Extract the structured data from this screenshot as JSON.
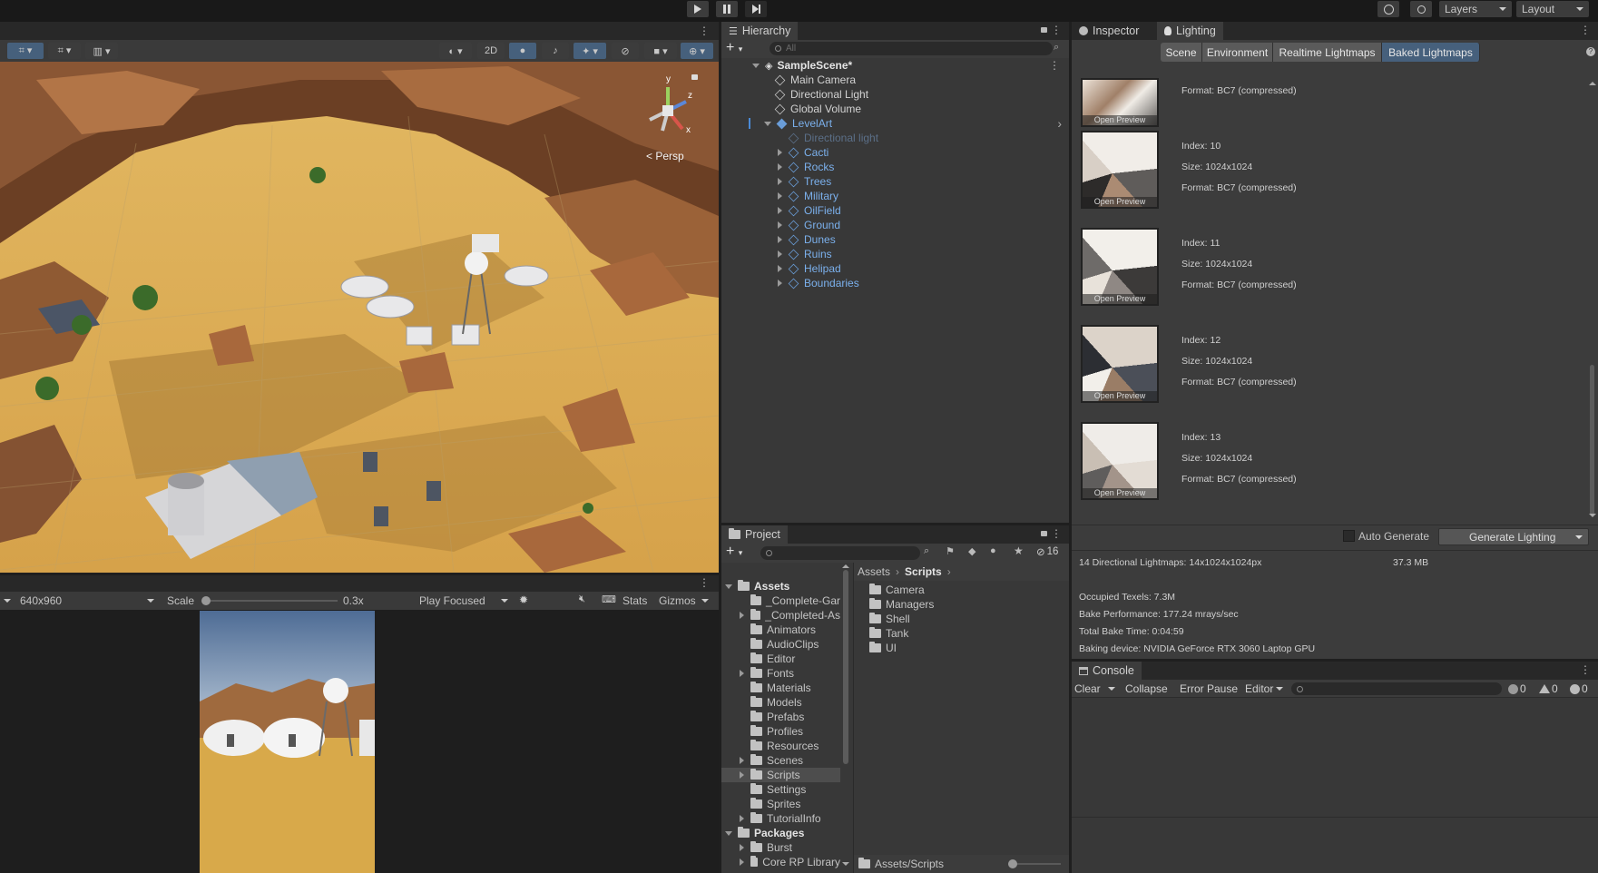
{
  "toolbar": {
    "play_icon": "play-icon",
    "pause_icon": "pause-icon",
    "step_icon": "step-icon",
    "layers_label": "Layers",
    "layout_label": "Layout"
  },
  "scene_view": {
    "persp_label": "< Persp",
    "mode_2d_label": "2D",
    "gizmo_axes": [
      "y",
      "z",
      "x"
    ]
  },
  "game_view": {
    "resolution": "640x960",
    "scale_label": "Scale",
    "scale_value": "0.3x",
    "scale_level": 0.0,
    "play_mode": "Play Focused",
    "stats_label": "Stats",
    "gizmos_label": "Gizmos"
  },
  "hierarchy": {
    "tab_label": "Hierarchy",
    "search_placeholder": "All",
    "scene_name": "SampleScene*",
    "items": [
      {
        "label": "Main Camera",
        "indent": 1,
        "state": "normal"
      },
      {
        "label": "Directional Light",
        "indent": 1,
        "state": "normal"
      },
      {
        "label": "Global Volume",
        "indent": 1,
        "state": "normal"
      },
      {
        "label": "LevelArt",
        "indent": 1,
        "state": "prefab-expanded"
      },
      {
        "label": "Directional light",
        "indent": 2,
        "state": "disabled"
      },
      {
        "label": "Cacti",
        "indent": 2,
        "state": "prefab"
      },
      {
        "label": "Rocks",
        "indent": 2,
        "state": "prefab"
      },
      {
        "label": "Trees",
        "indent": 2,
        "state": "prefab"
      },
      {
        "label": "Military",
        "indent": 2,
        "state": "prefab"
      },
      {
        "label": "OilField",
        "indent": 2,
        "state": "prefab"
      },
      {
        "label": "Ground",
        "indent": 2,
        "state": "prefab"
      },
      {
        "label": "Dunes",
        "indent": 2,
        "state": "prefab"
      },
      {
        "label": "Ruins",
        "indent": 2,
        "state": "prefab"
      },
      {
        "label": "Helipad",
        "indent": 2,
        "state": "prefab"
      },
      {
        "label": "Boundaries",
        "indent": 2,
        "state": "prefab"
      }
    ]
  },
  "inspector": {
    "tab_inspector": "Inspector",
    "tab_lighting": "Lighting",
    "segments": [
      "Scene",
      "Environment",
      "Realtime Lightmaps",
      "Baked Lightmaps"
    ],
    "active_segment": "Baked Lightmaps",
    "top_format": "Format: BC7 (compressed)",
    "open_preview": "Open Preview",
    "lightmaps": [
      {
        "index": "Index: 10",
        "size": "Size: 1024x1024",
        "format": "Format: BC7 (compressed)"
      },
      {
        "index": "Index: 11",
        "size": "Size: 1024x1024",
        "format": "Format: BC7 (compressed)"
      },
      {
        "index": "Index: 12",
        "size": "Size: 1024x1024",
        "format": "Format: BC7 (compressed)"
      },
      {
        "index": "Index: 13",
        "size": "Size: 1024x1024",
        "format": "Format: BC7 (compressed)"
      }
    ],
    "auto_generate_label": "Auto Generate",
    "generate_button": "Generate Lighting",
    "summary_lightmaps": "14 Directional Lightmaps: 14x1024x1024px",
    "summary_size": "37.3 MB",
    "stats": [
      "Occupied Texels: 7.3M",
      "Bake Performance: 177.24 mrays/sec",
      "Total Bake Time: 0:04:59",
      "Baking device: NVIDIA GeForce RTX 3060 Laptop GPU"
    ]
  },
  "project": {
    "tab_label": "Project",
    "hidden_count": "16",
    "breadcrumb_root": "Assets",
    "breadcrumb_current": "Scripts",
    "tree": [
      {
        "label": "Assets",
        "type": "root",
        "expanded": true
      },
      {
        "label": "_Complete-Gar",
        "type": "folder",
        "arrow": false
      },
      {
        "label": "_Completed-As",
        "type": "folder",
        "arrow": true
      },
      {
        "label": "Animators",
        "type": "folder",
        "arrow": false
      },
      {
        "label": "AudioClips",
        "type": "folder",
        "arrow": false
      },
      {
        "label": "Editor",
        "type": "folder",
        "arrow": false
      },
      {
        "label": "Fonts",
        "type": "folder",
        "arrow": true
      },
      {
        "label": "Materials",
        "type": "folder",
        "arrow": false
      },
      {
        "label": "Models",
        "type": "folder",
        "arrow": false
      },
      {
        "label": "Prefabs",
        "type": "folder",
        "arrow": false
      },
      {
        "label": "Profiles",
        "type": "folder",
        "arrow": false
      },
      {
        "label": "Resources",
        "type": "folder",
        "arrow": false
      },
      {
        "label": "Scenes",
        "type": "folder",
        "arrow": true
      },
      {
        "label": "Scripts",
        "type": "folder",
        "arrow": true,
        "selected": true
      },
      {
        "label": "Settings",
        "type": "folder",
        "arrow": false
      },
      {
        "label": "Sprites",
        "type": "folder",
        "arrow": false
      },
      {
        "label": "TutorialInfo",
        "type": "folder",
        "arrow": true
      },
      {
        "label": "Packages",
        "type": "root",
        "expanded": true
      },
      {
        "label": "Burst",
        "type": "folder",
        "arrow": true
      },
      {
        "label": "Core RP Library",
        "type": "folder",
        "arrow": true
      }
    ],
    "contents": [
      "Camera",
      "Managers",
      "Shell",
      "Tank",
      "UI"
    ],
    "footer_path": "Assets/Scripts"
  },
  "console": {
    "tab_label": "Console",
    "clear_label": "Clear",
    "collapse_label": "Collapse",
    "error_pause_label": "Error Pause",
    "editor_label": "Editor",
    "log_count": "0",
    "warn_count": "0",
    "error_count": "0"
  }
}
